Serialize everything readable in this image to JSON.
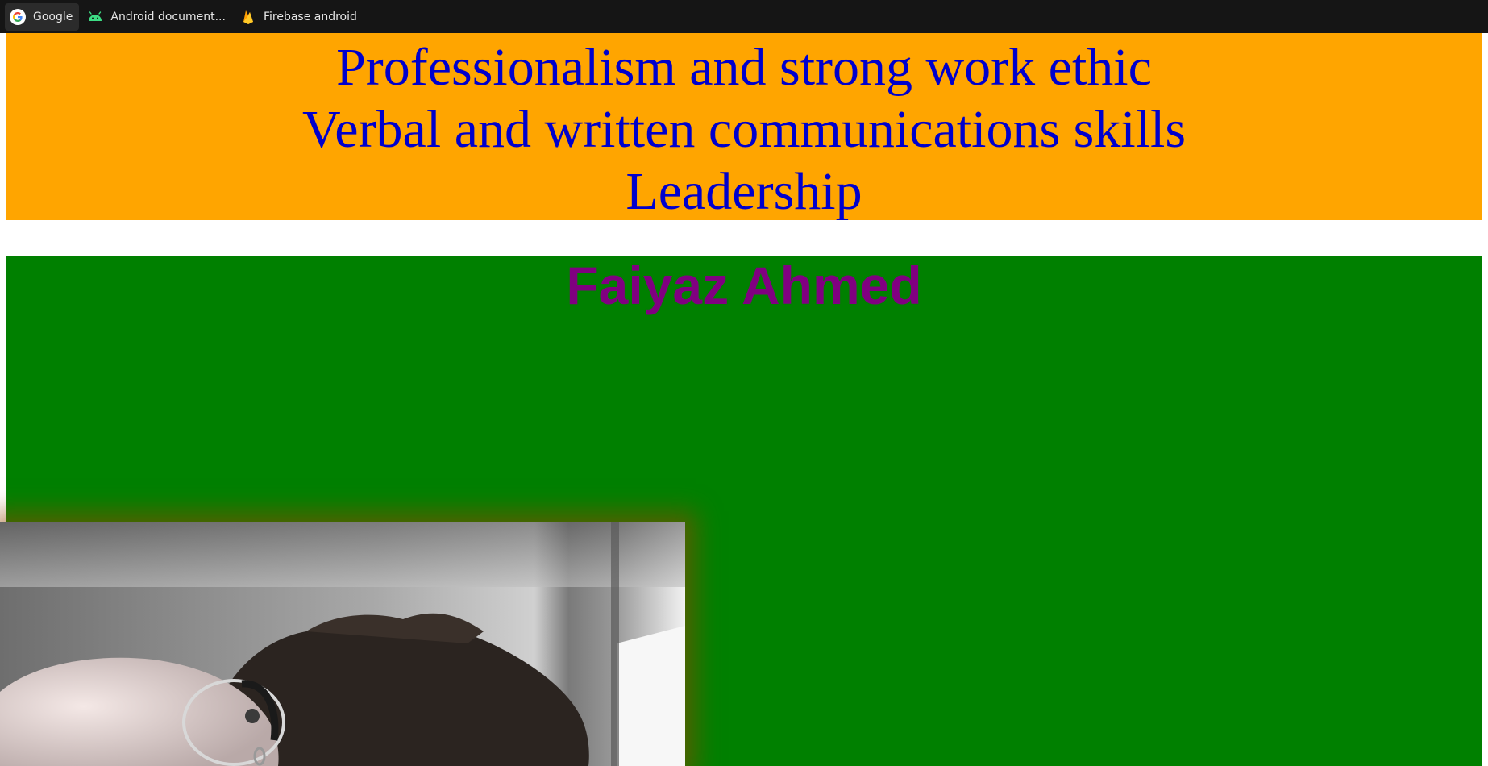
{
  "bookmarks": [
    {
      "label": "Google",
      "icon": "google-icon"
    },
    {
      "label": "Android document...",
      "icon": "android-icon"
    },
    {
      "label": "Firebase android",
      "icon": "firebase-icon"
    }
  ],
  "skills": [
    "Professionalism and strong work ethic",
    "Verbal and written communications skills",
    "Leadership"
  ],
  "profile": {
    "name": "Faiyaz Ahmed"
  },
  "colors": {
    "bookmarks_bar": "#151515",
    "skills_background": "#ffa500",
    "skills_text": "#0000cd",
    "profile_background": "#008000",
    "name_text": "#800080"
  }
}
